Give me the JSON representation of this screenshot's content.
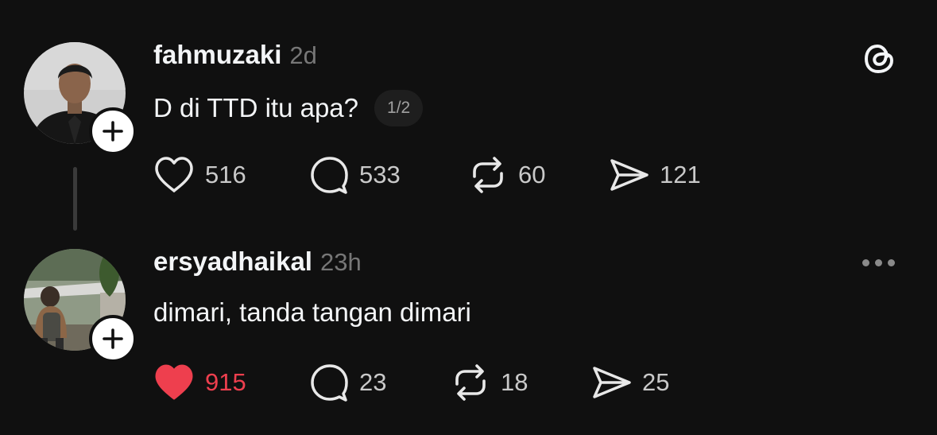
{
  "posts": [
    {
      "username": "fahmuzaki",
      "time": "2d",
      "text": "D di TTD itu apa?",
      "pager": "1/2",
      "likes": "516",
      "replies": "533",
      "reposts": "60",
      "shares": "121",
      "liked": false
    },
    {
      "username": "ersyadhaikal",
      "time": "23h",
      "text": "dimari, tanda tangan dimari",
      "likes": "915",
      "replies": "23",
      "reposts": "18",
      "shares": "25",
      "liked": true
    }
  ],
  "colors": {
    "background": "#101010",
    "liked": "#ee3f4e",
    "muted": "#777777"
  },
  "icons": [
    "threads-logo-icon",
    "heart-icon",
    "reply-icon",
    "repost-icon",
    "share-icon",
    "more-icon",
    "follow-plus-icon"
  ]
}
